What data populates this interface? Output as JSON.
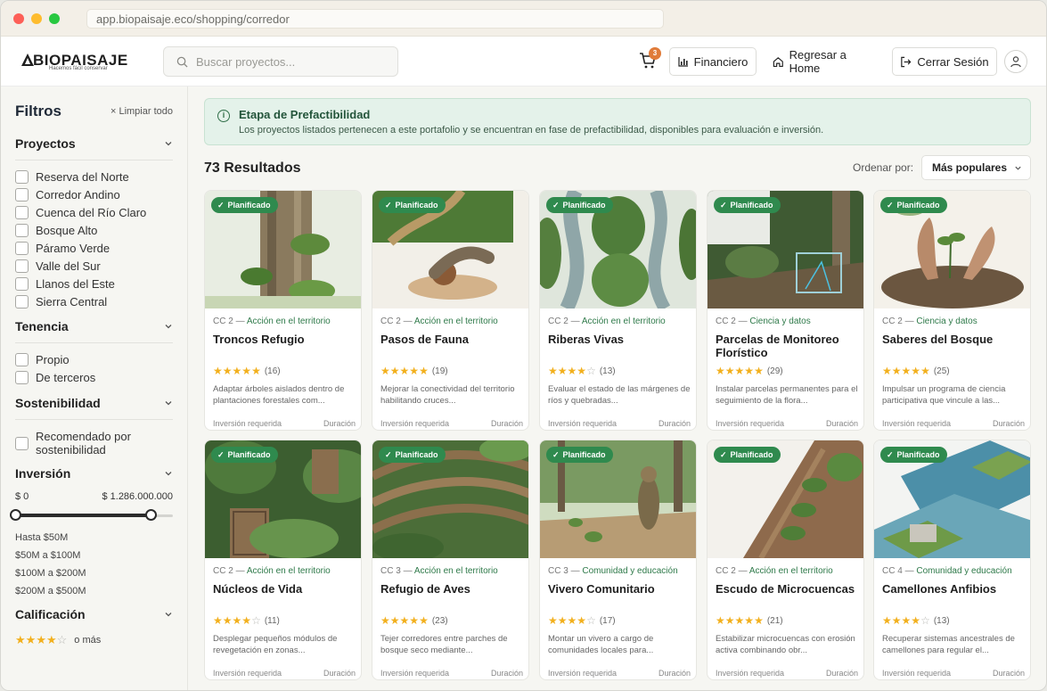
{
  "browser": {
    "url": "app.biopaisaje.eco/shopping/corredor"
  },
  "header": {
    "logo": "BIOPAISAJE",
    "logo_tagline": "Hacemos fácil conservar",
    "search_placeholder": "Buscar proyectos...",
    "cart_count": "3",
    "financiero": "Financiero",
    "home": "Regresar a Home",
    "logout": "Cerrar Sesión"
  },
  "sidebar": {
    "title": "Filtros",
    "clear": "Limpiar todo",
    "proyectos": {
      "title": "Proyectos",
      "items": [
        "Reserva del Norte",
        "Corredor Andino",
        "Cuenca del Río Claro",
        "Bosque Alto",
        "Páramo Verde",
        "Valle del Sur",
        "Llanos del Este",
        "Sierra Central"
      ]
    },
    "tenencia": {
      "title": "Tenencia",
      "items": [
        "Propio",
        "De terceros"
      ]
    },
    "sostenibilidad": {
      "title": "Sostenibilidad",
      "items": [
        "Recomendado por sostenibilidad"
      ]
    },
    "inversion": {
      "title": "Inversión",
      "min": "$ 0",
      "max": "$ 1.286.000.000",
      "slider_min_fraction": 0,
      "slider_max_fraction": 1,
      "options": [
        "Hasta $50M",
        "$50M a $100M",
        "$100M a $200M",
        "$200M a $500M"
      ]
    },
    "calificacion": {
      "title": "Calificación",
      "stars": 4,
      "label": "o más"
    }
  },
  "alert": {
    "title": "Etapa de Prefactibilidad",
    "text": "Los proyectos listados pertenecen a este portafolio y se encuentran en fase de prefactibilidad, disponibles para evaluación e inversión."
  },
  "results": {
    "label": "73 Resultados",
    "sort_label": "Ordenar por:",
    "sort_value": "Más populares"
  },
  "cards": [
    {
      "tag": "Planificado",
      "code": "CC 2",
      "category": "Acción en el territorio",
      "title": "Troncos Refugio",
      "stars": 5,
      "count": "(16)",
      "desc": "Adaptar árboles aislados dentro de plantaciones forestales com...",
      "foot_left": "Inversión requerida",
      "foot_right": "Duración"
    },
    {
      "tag": "Planificado",
      "code": "CC 2",
      "category": "Acción en el territorio",
      "title": "Pasos de Fauna",
      "stars": 5,
      "count": "(19)",
      "desc": "Mejorar la conectividad del territorio habilitando cruces...",
      "foot_left": "Inversión requerida",
      "foot_right": "Duración"
    },
    {
      "tag": "Planificado",
      "code": "CC 2",
      "category": "Acción en el territorio",
      "title": "Riberas Vivas",
      "stars": 4,
      "count": "(13)",
      "desc": "Evaluar el estado de las márgenes de ríos y quebradas...",
      "foot_left": "Inversión requerida",
      "foot_right": "Duración"
    },
    {
      "tag": "Planificado",
      "code": "CC 2",
      "category": "Ciencia y datos",
      "title": "Parcelas de Monitoreo Florístico",
      "stars": 5,
      "count": "(29)",
      "desc": "Instalar parcelas permanentes para el seguimiento de la flora...",
      "foot_left": "Inversión requerida",
      "foot_right": "Duración"
    },
    {
      "tag": "Planificado",
      "code": "CC 2",
      "category": "Ciencia y datos",
      "title": "Saberes del Bosque",
      "stars": 5,
      "count": "(25)",
      "desc": "Impulsar un programa de ciencia participativa que vincule a las...",
      "foot_left": "Inversión requerida",
      "foot_right": "Duración"
    },
    {
      "tag": "Planificado",
      "code": "CC 2",
      "category": "Acción en el territorio",
      "title": "Núcleos de Vida",
      "stars": 4,
      "count": "(11)",
      "desc": "Desplegar pequeños módulos de revegetación en zonas...",
      "foot_left": "Inversión requerida",
      "foot_right": "Duración"
    },
    {
      "tag": "Planificado",
      "code": "CC 3",
      "category": "Acción en el territorio",
      "title": "Refugio de Aves",
      "stars": 5,
      "count": "(23)",
      "desc": "Tejer corredores entre parches de bosque seco mediante...",
      "foot_left": "Inversión requerida",
      "foot_right": "Duración"
    },
    {
      "tag": "Planificado",
      "code": "CC 3",
      "category": "Comunidad y educación",
      "title": "Vivero Comunitario",
      "stars": 4,
      "count": "(17)",
      "desc": "Montar un vivero a cargo de comunidades locales para...",
      "foot_left": "Inversión requerida",
      "foot_right": "Duración"
    },
    {
      "tag": "Planificado",
      "code": "CC 2",
      "category": "Acción en el territorio",
      "title": "Escudo de Microcuencas",
      "stars": 5,
      "count": "(21)",
      "desc": "Estabilizar microcuencas con erosión activa combinando obr...",
      "foot_left": "Inversión requerida",
      "foot_right": "Duración"
    },
    {
      "tag": "Planificado",
      "code": "CC 4",
      "category": "Comunidad y educación",
      "title": "Camellones Anfibios",
      "stars": 4,
      "count": "(13)",
      "desc": "Recuperar sistemas ancestrales de camellones para regular el...",
      "foot_left": "Inversión requerida",
      "foot_right": "Duración"
    }
  ],
  "colors": {
    "accent": "#2f8a4e",
    "star": "#f2b01e",
    "alert_bg": "#e4f2ea",
    "badge": "#e07b39"
  }
}
